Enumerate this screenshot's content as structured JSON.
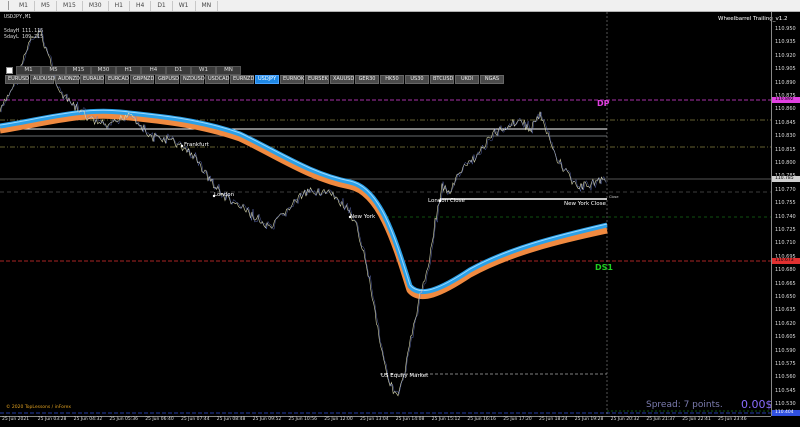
{
  "toolbar": {
    "timeframes": [
      "M1",
      "M5",
      "M15",
      "M30",
      "H1",
      "H4",
      "D1",
      "W1",
      "MN"
    ]
  },
  "chart": {
    "symbol_header": "USDJPY,M1",
    "bid_line": "5dayH 111.116",
    "ask_line": "5dayL 109.715",
    "ea_name": "Wheelbarrel Trailing_v1.2",
    "timeframe_buttons": [
      "M1",
      "M5",
      "M15",
      "M30",
      "H1",
      "H4",
      "D1",
      "W1",
      "MN"
    ],
    "symbols": [
      "EURUSD",
      "AUDUSD",
      "AUDNZD",
      "EURAUD",
      "EURCAD",
      "GBPNZD",
      "GBPUSD",
      "NZDUSD",
      "USDCAD",
      "EURNZD",
      "USDJPY",
      "EURNOK",
      "EURSEK",
      "XAUUSD",
      "GER30",
      "HK50",
      "US30",
      "BTCUSD",
      "UKOI",
      "NGAS"
    ],
    "active_symbol": "USDJPY",
    "session_labels": {
      "frankfurt": "Frankfurt",
      "london": "London",
      "new_york": "New York",
      "london_close": "London Close",
      "new_york_close": "New York Close",
      "us_equity": "US Equity Market"
    },
    "level_labels": {
      "dp": "DP",
      "ds1": "DS1",
      "right_small": "Close"
    },
    "copyright": "© 2020 TopLessons / inForex",
    "spread_label": "Spread: 7 points.",
    "spread_value": "0.00$",
    "price_labels": [
      "110.950",
      "110.935",
      "110.920",
      "110.905",
      "110.890",
      "110.875",
      "110.860",
      "110.845",
      "110.830",
      "110.815",
      "110.800",
      "110.785",
      "110.770",
      "110.755",
      "110.740",
      "110.725",
      "110.710",
      "110.695",
      "110.680",
      "110.665",
      "110.650",
      "110.635",
      "110.620",
      "110.605",
      "110.590",
      "110.575",
      "110.560",
      "110.545",
      "110.530"
    ],
    "price_tags": {
      "dp": "110.892",
      "ds1": "110.673",
      "current": "110.785",
      "bottom": "110.404"
    },
    "time_labels": [
      "25 Jun 2021",
      "25 Jun 03:28",
      "25 Jun 04:32",
      "25 Jun 05:36",
      "25 Jun 06:40",
      "25 Jun 07:44",
      "25 Jun 08:48",
      "25 Jun 09:52",
      "25 Jun 10:56",
      "25 Jun 12:00",
      "25 Jun 13:04",
      "25 Jun 14:08",
      "25 Jun 15:12",
      "25 Jun 16:16",
      "25 Jun 17:20",
      "25 Jun 18:24",
      "25 Jun 19:28",
      "25 Jun 20:32",
      "25 Jun 21:37",
      "25 Jun 22:41",
      "25 Jun 23:46"
    ],
    "colors": {
      "dp": "#e040e0",
      "ds1": "#20d020",
      "pivot_red": "#e03030",
      "ma_blue": "#2aa0e8",
      "ma_orange": "#f08a40",
      "active_symbol": "#1e88e5",
      "price_line": "#d8d8b0"
    }
  }
}
